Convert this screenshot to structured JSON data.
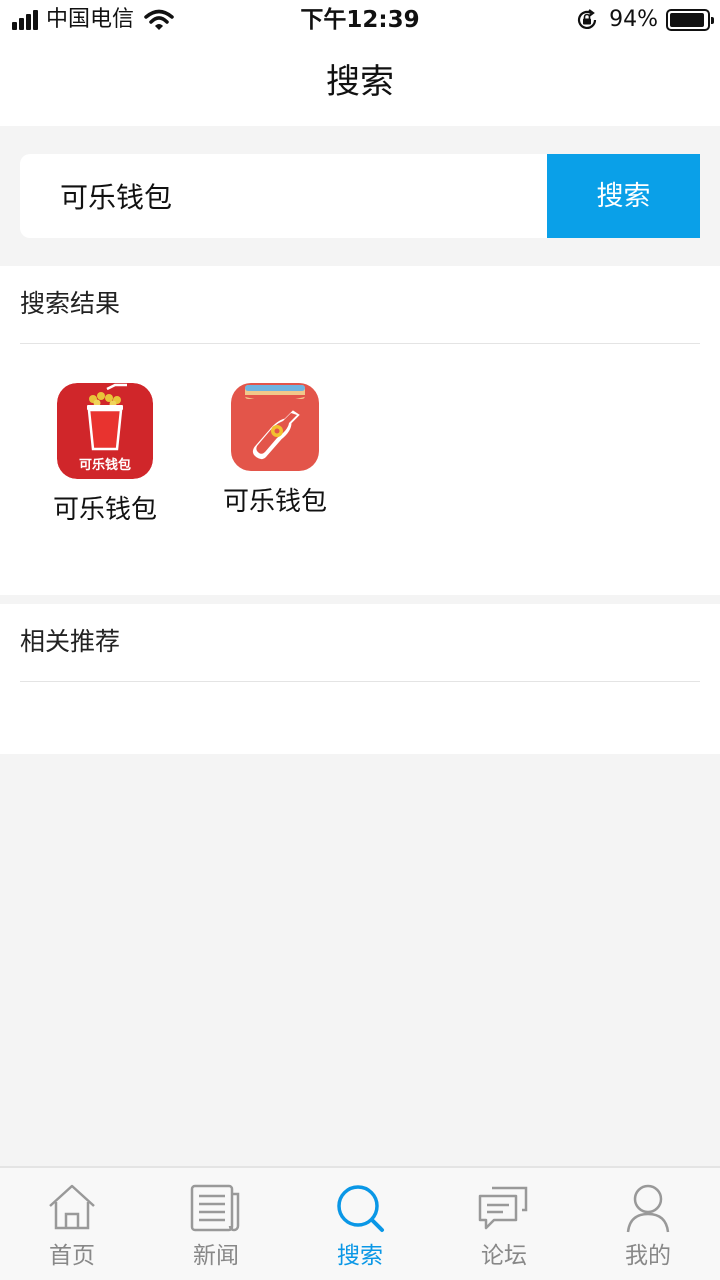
{
  "status_bar": {
    "carrier": "中国电信",
    "time": "下午12:39",
    "battery": "94%",
    "battery_level": 0.94
  },
  "header": {
    "title": "搜索"
  },
  "search": {
    "query": "可乐钱包",
    "button_label": "搜索"
  },
  "results": {
    "title": "搜索结果",
    "apps": [
      {
        "name": "可乐钱包",
        "icon": "cola-cup-app-icon",
        "icon_text": "可乐钱包"
      },
      {
        "name": "可乐钱包",
        "icon": "cola-wallet-bottle-app-icon"
      }
    ]
  },
  "related": {
    "title": "相关推荐"
  },
  "tabbar": {
    "items": [
      {
        "label": "首页",
        "icon": "home-icon"
      },
      {
        "label": "新闻",
        "icon": "news-icon"
      },
      {
        "label": "搜索",
        "icon": "search-icon",
        "active": true
      },
      {
        "label": "论坛",
        "icon": "chat-icon"
      },
      {
        "label": "我的",
        "icon": "user-icon"
      }
    ]
  },
  "colors": {
    "accent": "#0aa0e8",
    "app1_bg": "#d0262a",
    "app2_bg": "#e3554a"
  }
}
